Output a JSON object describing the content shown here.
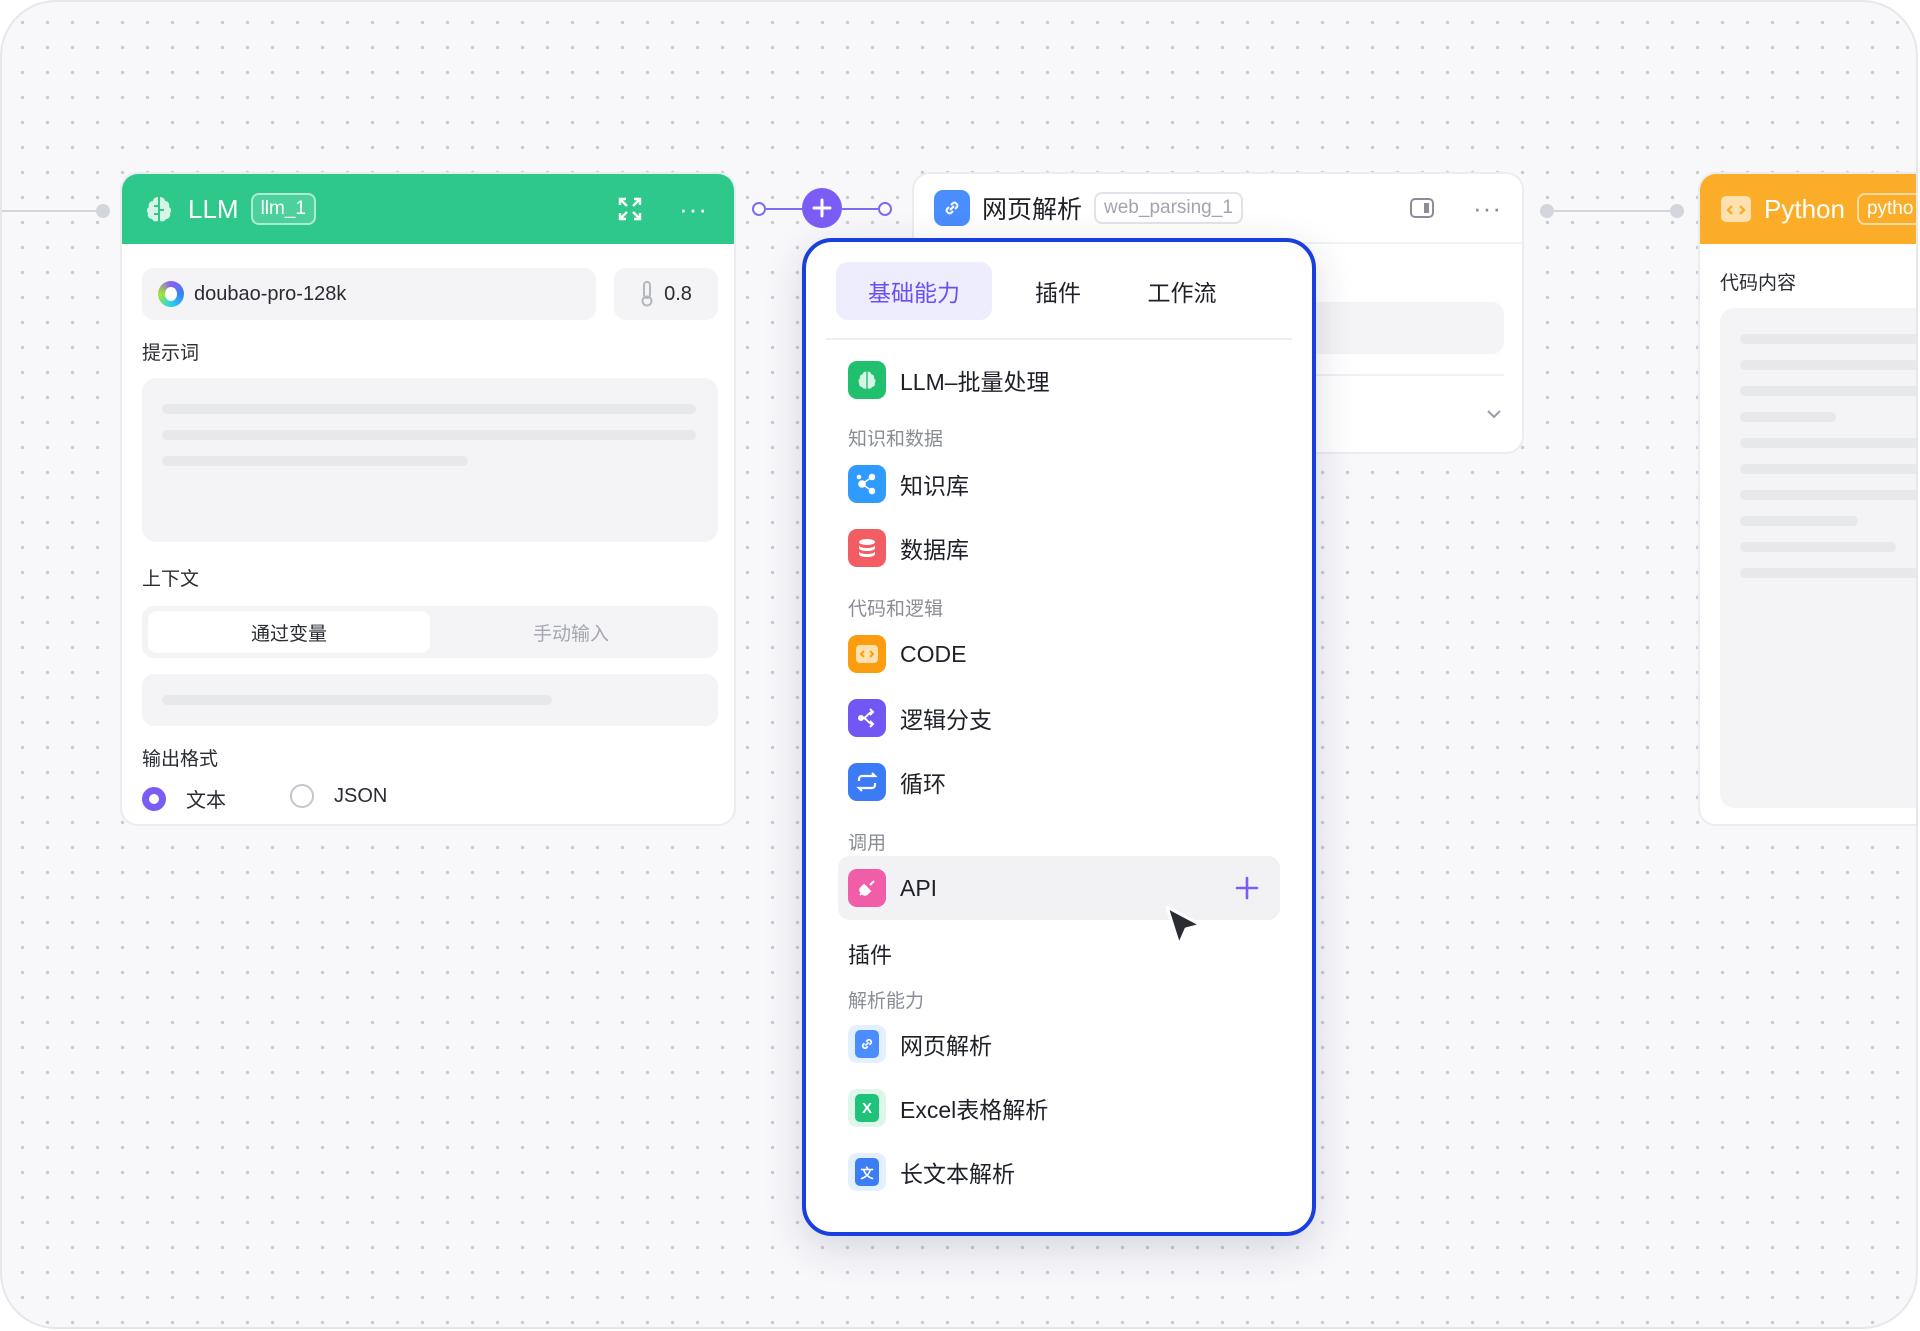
{
  "llm_node": {
    "title": "LLM",
    "tag": "llm_1",
    "model": "doubao-pro-128k",
    "temperature": "0.8",
    "prompt_label": "提示词",
    "context_label": "上下文",
    "context_tabs": [
      "通过变量",
      "手动输入"
    ],
    "output_label": "输出格式",
    "output_options": [
      "文本",
      "JSON"
    ],
    "output_selected": "文本",
    "header_color": "#2ec98a"
  },
  "web_node": {
    "title": "网页解析",
    "tag": "web_parsing_1"
  },
  "python_node": {
    "title": "Python",
    "tag": "pytho",
    "code_label": "代码内容",
    "header_color": "#fbad2a"
  },
  "menu": {
    "tabs": [
      "基础能力",
      "插件",
      "工作流"
    ],
    "active_tab": "基础能力",
    "top_item": {
      "label": "LLM–批量处理",
      "icon": "brain-icon",
      "color": "#20c06f"
    },
    "sections": [
      {
        "title": "知识和数据",
        "items": [
          {
            "label": "知识库",
            "icon": "share-nodes-icon",
            "color": "#2f9bff"
          },
          {
            "label": "数据库",
            "icon": "database-icon",
            "color": "#f25d63"
          }
        ]
      },
      {
        "title": "代码和逻辑",
        "items": [
          {
            "label": "CODE",
            "icon": "code-icon",
            "color": "#fb9d0f"
          },
          {
            "label": "逻辑分支",
            "icon": "branch-icon",
            "color": "#7357f5"
          },
          {
            "label": "循环",
            "icon": "loop-icon",
            "color": "#3b7cf6"
          }
        ]
      },
      {
        "title": "调用",
        "items": [
          {
            "label": "API",
            "icon": "plug-icon",
            "color": "#f25da8"
          }
        ]
      }
    ],
    "plugin_heading": "插件",
    "parse_section": {
      "title": "解析能力",
      "items": [
        {
          "label": "网页解析",
          "icon": "link-doc-icon",
          "color": "#4a8dff"
        },
        {
          "label": "Excel表格解析",
          "icon": "excel-icon",
          "color": "#1fc27a"
        },
        {
          "label": "长文本解析",
          "icon": "text-doc-icon",
          "color": "#3a7df5"
        }
      ]
    },
    "accent": "#7b5cf5",
    "border": "#1a3fe0"
  }
}
